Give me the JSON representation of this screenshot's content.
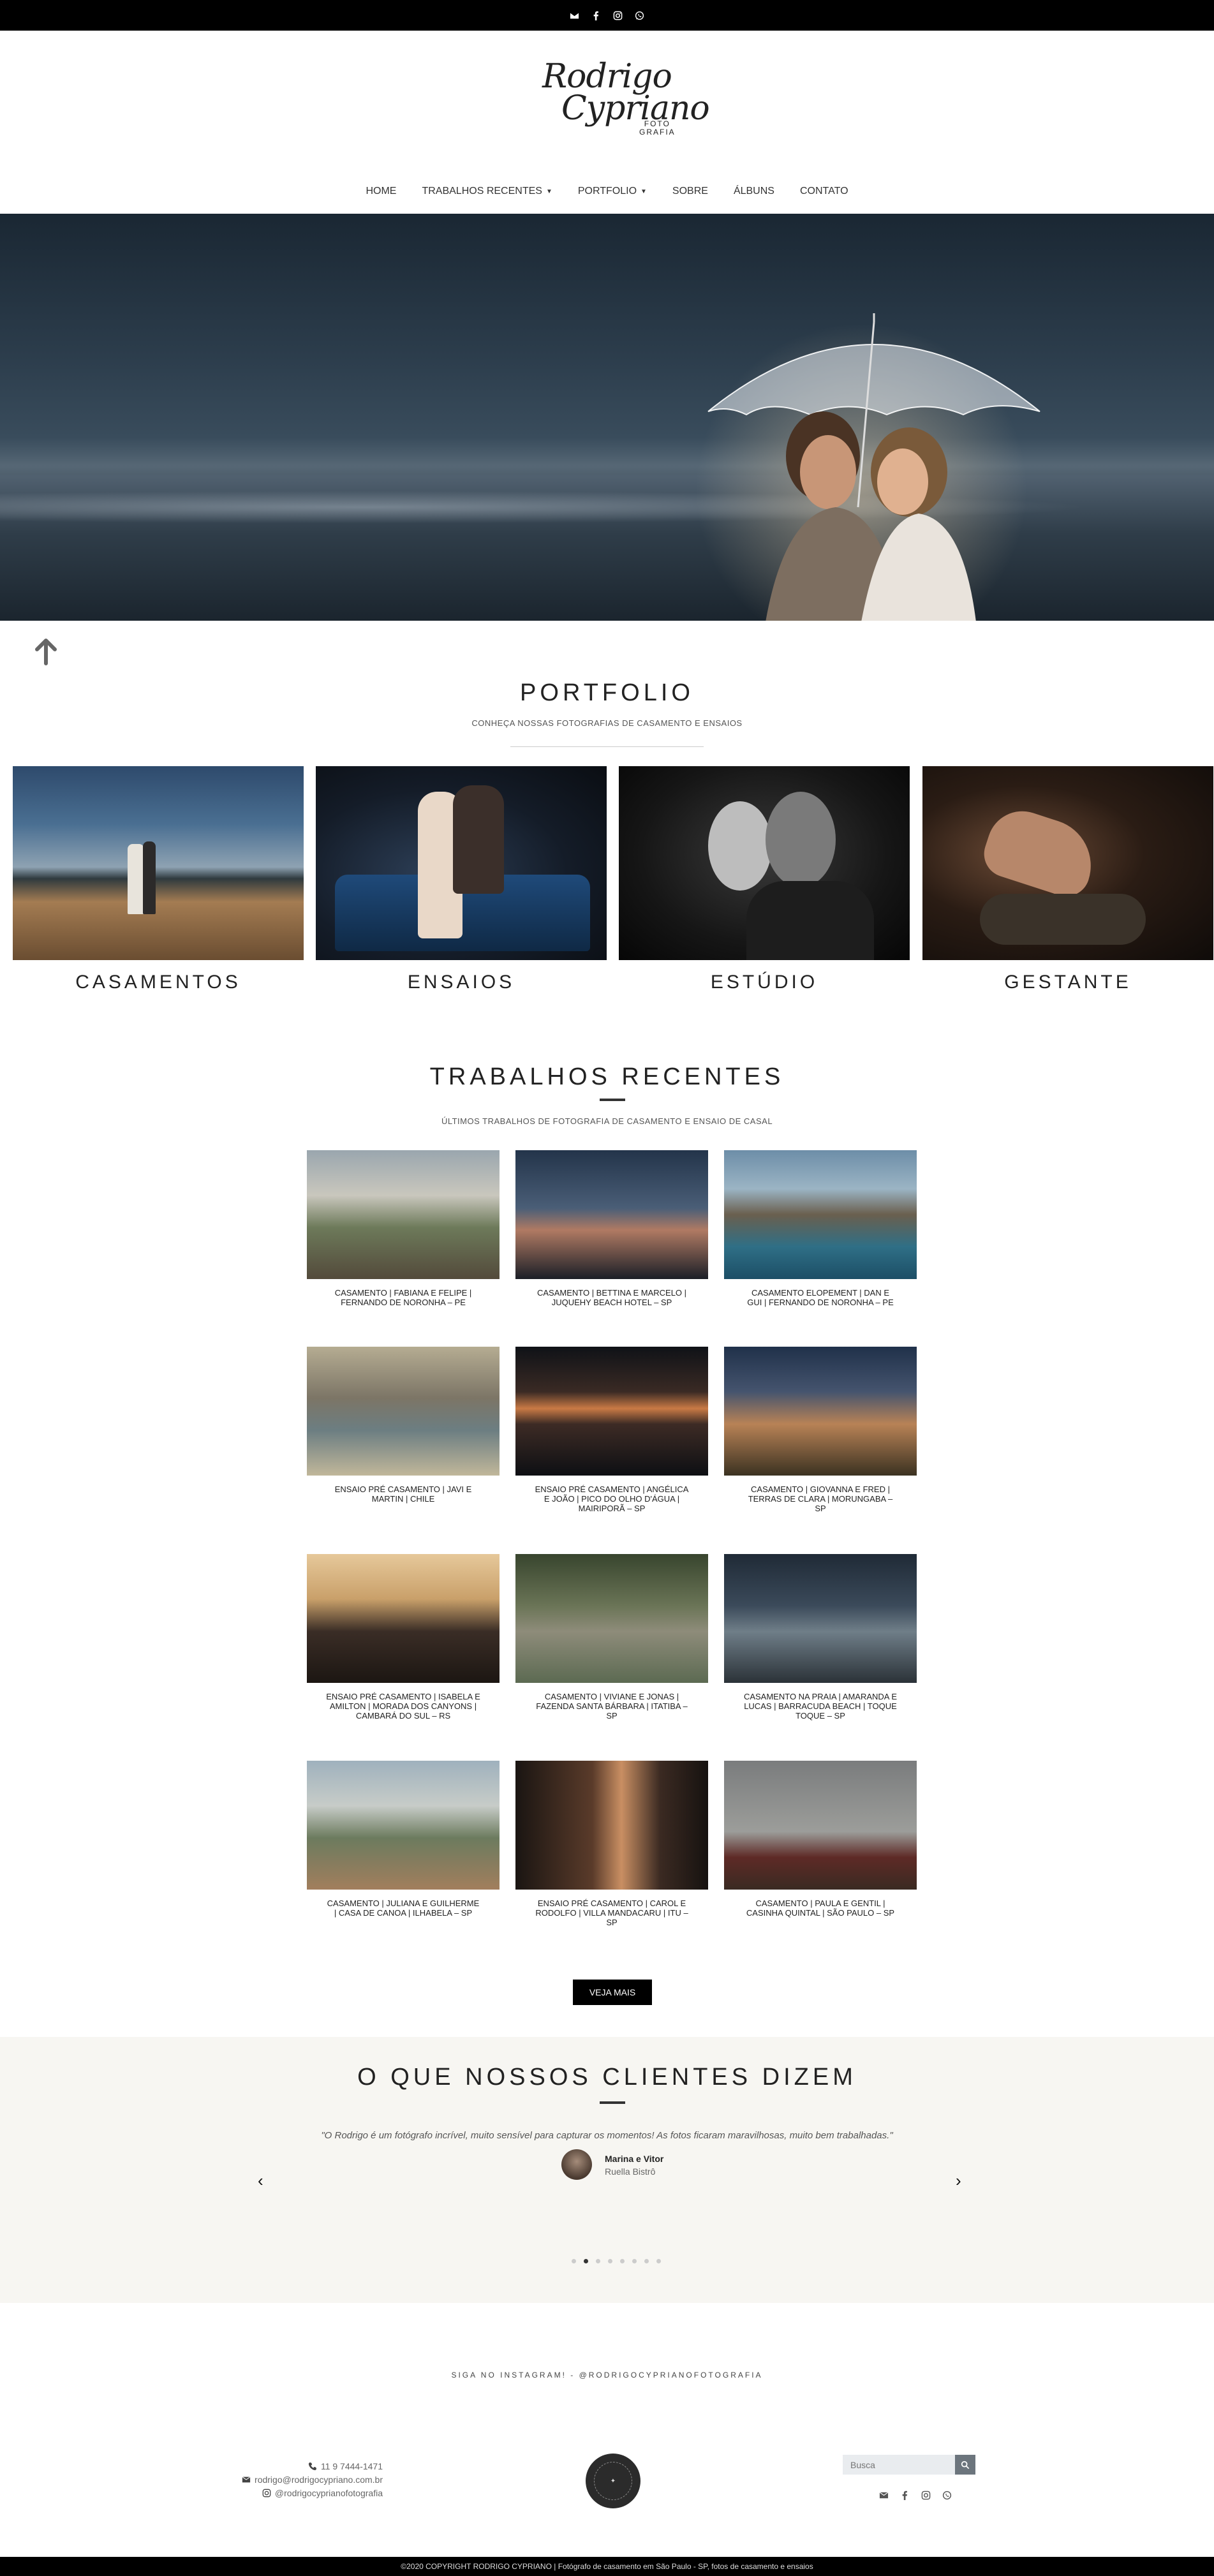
{
  "topbar": {
    "icons": [
      "envelope-icon",
      "facebook-icon",
      "instagram-icon",
      "whatsapp-icon"
    ]
  },
  "logo": {
    "line1": "Rodrigo",
    "line2": "Cypriano",
    "line3a": "FOTO",
    "line3b": "GRAFIA"
  },
  "nav": {
    "items": [
      {
        "label": "HOME",
        "dropdown": false
      },
      {
        "label": "TRABALHOS RECENTES",
        "dropdown": true
      },
      {
        "label": "PORTFOLIO",
        "dropdown": true
      },
      {
        "label": "SOBRE",
        "dropdown": false
      },
      {
        "label": "ÁLBUNS",
        "dropdown": false
      },
      {
        "label": "CONTATO",
        "dropdown": false
      }
    ]
  },
  "portfolio": {
    "title": "PORTFOLIO",
    "subtitle": "CONHEÇA NOSSAS FOTOGRAFIAS DE CASAMENTO E ENSAIOS",
    "cards": [
      {
        "label": "CASAMENTOS"
      },
      {
        "label": "ENSAIOS"
      },
      {
        "label": "ESTÚDIO"
      },
      {
        "label": "GESTANTE"
      }
    ]
  },
  "recent": {
    "title": "TRABALHOS RECENTES",
    "subtitle": "ÚLTIMOS TRABALHOS DE FOTOGRAFIA DE CASAMENTO E ENSAIO DE CASAL",
    "items": [
      {
        "label": "CASAMENTO | FABIANA E FELIPE | FERNANDO DE NORONHA – PE"
      },
      {
        "label": "CASAMENTO | BETTINA E MARCELO | JUQUEHY BEACH HOTEL – SP"
      },
      {
        "label": "CASAMENTO ELOPEMENT | DAN E GUI | FERNANDO DE NORONHA – PE"
      },
      {
        "label": "ENSAIO PRÉ CASAMENTO | JAVI E MARTIN | CHILE"
      },
      {
        "label": "ENSAIO PRÉ CASAMENTO | ANGÉLICA E JOÃO | PICO DO OLHO D'ÁGUA | MAIRIPORÃ – SP"
      },
      {
        "label": "CASAMENTO | GIOVANNA E FRED | TERRAS DE CLARA | MORUNGABA – SP"
      },
      {
        "label": "ENSAIO PRÉ CASAMENTO | ISABELA E AMILTON | MORADA DOS CANYONS | CAMBARÁ DO SUL – RS"
      },
      {
        "label": "CASAMENTO | VIVIANE E JONAS | FAZENDA SANTA BÁRBARA | ITATIBA – SP"
      },
      {
        "label": "CASAMENTO NA PRAIA | AMARANDA E LUCAS | BARRACUDA BEACH | TOQUE TOQUE – SP"
      },
      {
        "label": "CASAMENTO | JULIANA E GUILHERME | CASA DE CANOA | ILHABELA – SP"
      },
      {
        "label": "ENSAIO PRÉ CASAMENTO | CAROL E RODOLFO | VILLA MANDACARU | ITU – SP"
      },
      {
        "label": "CASAMENTO | PAULA E GENTIL | CASINHA QUINTAL | SÃO PAULO – SP"
      }
    ],
    "more_label": "VEJA MAIS"
  },
  "testimonials": {
    "title": "O QUE NOSSOS CLIENTES DIZEM",
    "quote": "\"O Rodrigo é um fotógrafo incrível, muito sensível para capturar os momentos! As fotos ficaram maravilhosas, muito bem trabalhadas.\"",
    "name": "Marina e Vitor",
    "place": "Ruella Bistrô",
    "prev": "‹",
    "next": "›",
    "dot_count": 8,
    "active_dot": 1
  },
  "instagram": {
    "text": "SIGA NO INSTAGRAM! - @RODRIGOCYPRIANOFOTOGRAFIA"
  },
  "footer": {
    "phone": "11 9 7444-1471",
    "email": "rodrigo@rodrigocypriano.com.br",
    "instagram": "@rodrigocyprianofotografia",
    "search_placeholder": "Busca",
    "copyright": "©2020 COPYRIGHT RODRIGO CYPRIANO | Fotógrafo de casamento em São Paulo - SP, fotos de casamento e ensaios"
  }
}
